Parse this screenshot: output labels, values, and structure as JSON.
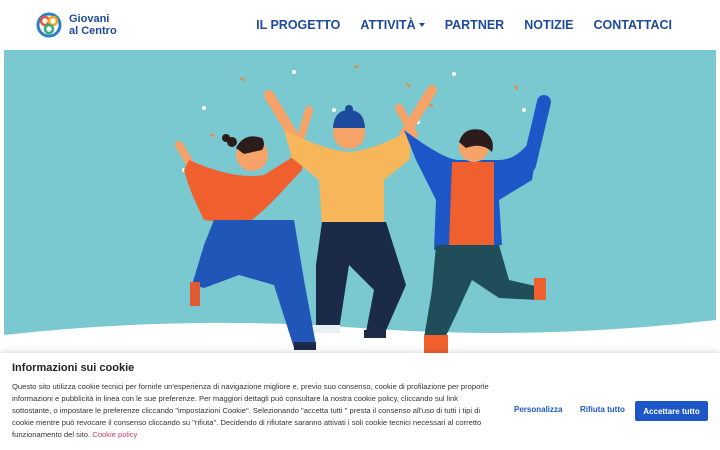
{
  "header": {
    "logo_line1": "Giovani",
    "logo_line2": "al Centro",
    "nav": [
      {
        "label": "IL PROGETTO"
      },
      {
        "label": "ATTIVITÀ"
      },
      {
        "label": "PARTNER"
      },
      {
        "label": "NOTIZIE"
      },
      {
        "label": "CONTATTACI"
      }
    ]
  },
  "colors": {
    "brand_blue": "#1d4a9b",
    "hero_background": "#7ac8d0",
    "button_primary": "#1d57c7",
    "link_pink": "#c23a6b"
  },
  "cookie": {
    "title": "Informazioni sui cookie",
    "text": "Questo sito utilizza cookie tecnici per fornirle un'esperienza di navigazione migliore e, previo suo consenso, cookie di profilazione per proporle informazioni e pubblicità in linea con le sue preferenze. Per maggiori dettagli può consultare la nostra cookie policy, cliccando sul link sottostante, o impostare le preferenze cliccando \"impostazioni Cookie\". Selezionando \"accetta tutti \" presta il consenso all'uso di tutti i tipi di cookie mentre può revocare il consenso cliccando su \"rifiuta\". Decidendo di rifiutare saranno attivati i soli cookie tecnici necessari al corretto funzionamento del sito.",
    "policy_link": "Cookie policy",
    "btn_personalize": "Personalizza",
    "btn_reject": "Rifiuta tutto",
    "btn_accept": "Accettare tutto"
  }
}
